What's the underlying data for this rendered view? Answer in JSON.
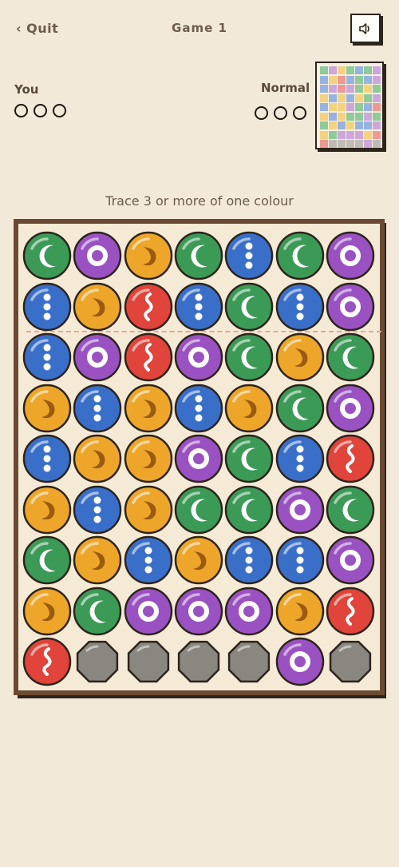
{
  "header": {
    "quit_label": "‹ Quit",
    "title": "Game 1",
    "sound_icon": "speaker-icon"
  },
  "players": {
    "you": {
      "label": "You",
      "dots": [
        0,
        0,
        0
      ]
    },
    "opponent": {
      "label": "Normal",
      "dots": [
        0,
        0,
        0
      ]
    }
  },
  "instruction": "Trace 3 or more of one colour",
  "colors": {
    "green": "#3c9a57",
    "purple": "#9a52c2",
    "orange": "#eda62a",
    "blue": "#3a6fc9",
    "red": "#e0443a",
    "stone": "#8a8680",
    "outline": "#2d241c",
    "background": "#f2e9d8"
  },
  "board": [
    [
      "green",
      "purple",
      "orange",
      "green",
      "blue",
      "green",
      "purple"
    ],
    [
      "blue",
      "orange",
      "red",
      "blue",
      "green",
      "blue",
      "purple"
    ],
    [
      "blue",
      "purple",
      "red",
      "purple",
      "green",
      "orange",
      "green"
    ],
    [
      "orange",
      "blue",
      "orange",
      "blue",
      "orange",
      "green",
      "purple"
    ],
    [
      "blue",
      "orange",
      "orange",
      "purple",
      "green",
      "blue",
      "red"
    ],
    [
      "orange",
      "blue",
      "orange",
      "green",
      "green",
      "purple",
      "green"
    ],
    [
      "green",
      "orange",
      "blue",
      "orange",
      "blue",
      "blue",
      "purple"
    ],
    [
      "orange",
      "green",
      "purple",
      "purple",
      "purple",
      "orange",
      "red"
    ],
    [
      "red",
      "stone",
      "stone",
      "stone",
      "stone",
      "purple",
      "stone"
    ]
  ],
  "minimap": [
    [
      "green",
      "purple",
      "orange",
      "green",
      "blue",
      "green",
      "purple"
    ],
    [
      "blue",
      "orange",
      "red",
      "blue",
      "green",
      "blue",
      "purple"
    ],
    [
      "blue",
      "purple",
      "red",
      "purple",
      "green",
      "orange",
      "green"
    ],
    [
      "orange",
      "blue",
      "orange",
      "blue",
      "orange",
      "green",
      "purple"
    ],
    [
      "blue",
      "orange",
      "orange",
      "purple",
      "green",
      "blue",
      "red"
    ],
    [
      "orange",
      "blue",
      "orange",
      "green",
      "green",
      "purple",
      "green"
    ],
    [
      "green",
      "orange",
      "blue",
      "orange",
      "blue",
      "blue",
      "purple"
    ],
    [
      "orange",
      "green",
      "purple",
      "purple",
      "purple",
      "orange",
      "red"
    ],
    [
      "red",
      "stone",
      "stone",
      "stone",
      "stone",
      "purple",
      "stone"
    ]
  ]
}
